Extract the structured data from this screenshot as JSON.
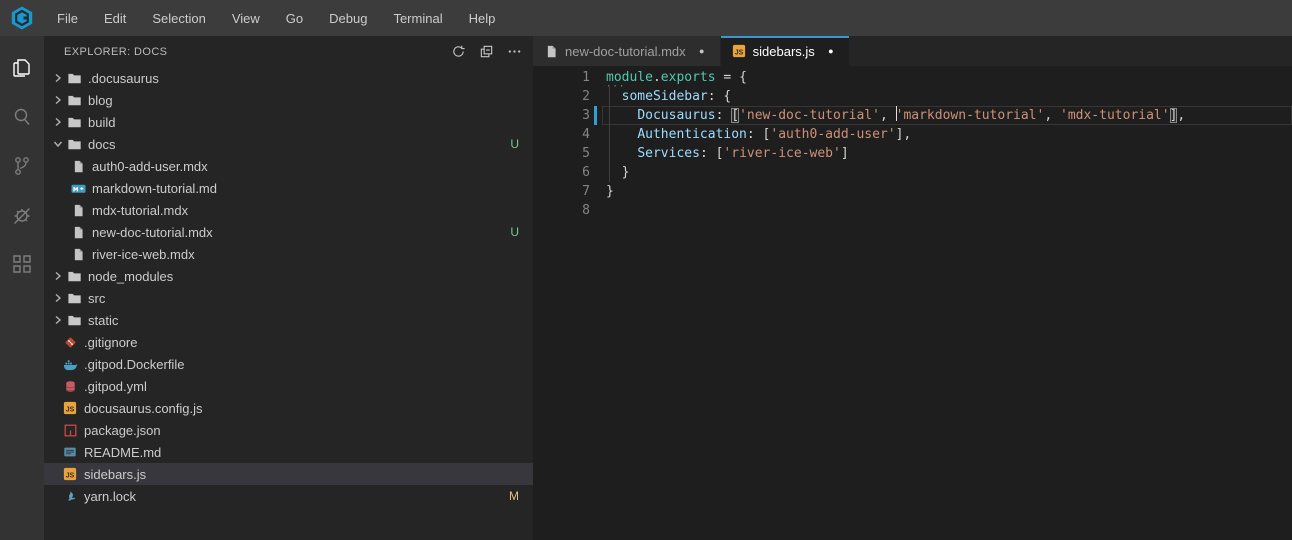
{
  "menubar": {
    "logo": "gitpod-logo",
    "items": [
      "File",
      "Edit",
      "Selection",
      "View",
      "Go",
      "Debug",
      "Terminal",
      "Help"
    ]
  },
  "activity_bar": {
    "items": [
      {
        "name": "explorer-icon",
        "active": true
      },
      {
        "name": "search-icon",
        "active": false
      },
      {
        "name": "source-control-icon",
        "active": false
      },
      {
        "name": "debug-icon",
        "active": false
      },
      {
        "name": "extensions-icon",
        "active": false
      }
    ]
  },
  "sidebar": {
    "title": "EXPLORER: DOCS",
    "actions": [
      {
        "name": "refresh-icon"
      },
      {
        "name": "collapse-folders-icon"
      },
      {
        "name": "more-actions-icon"
      }
    ],
    "tree": [
      {
        "type": "folder",
        "label": ".docusaurus",
        "depth": 0,
        "expanded": false,
        "badge": ""
      },
      {
        "type": "folder",
        "label": "blog",
        "depth": 0,
        "expanded": false,
        "badge": ""
      },
      {
        "type": "folder",
        "label": "build",
        "depth": 0,
        "expanded": false,
        "badge": ""
      },
      {
        "type": "folder",
        "label": "docs",
        "depth": 0,
        "expanded": true,
        "badge": "U"
      },
      {
        "type": "file",
        "icon": "file-icon",
        "label": "auth0-add-user.mdx",
        "depth": 1,
        "badge": ""
      },
      {
        "type": "file",
        "icon": "markdown-icon",
        "label": "markdown-tutorial.md",
        "depth": 1,
        "badge": ""
      },
      {
        "type": "file",
        "icon": "file-icon",
        "label": "mdx-tutorial.mdx",
        "depth": 1,
        "badge": ""
      },
      {
        "type": "file",
        "icon": "file-icon",
        "label": "new-doc-tutorial.mdx",
        "depth": 1,
        "badge": "U"
      },
      {
        "type": "file",
        "icon": "file-icon",
        "label": "river-ice-web.mdx",
        "depth": 1,
        "badge": ""
      },
      {
        "type": "folder",
        "label": "node_modules",
        "depth": 0,
        "expanded": false,
        "badge": ""
      },
      {
        "type": "folder",
        "label": "src",
        "depth": 0,
        "expanded": false,
        "badge": ""
      },
      {
        "type": "folder",
        "label": "static",
        "depth": 0,
        "expanded": false,
        "badge": ""
      },
      {
        "type": "file",
        "icon": "git-icon",
        "label": ".gitignore",
        "depth": 0,
        "badge": ""
      },
      {
        "type": "file",
        "icon": "docker-icon",
        "label": ".gitpod.Dockerfile",
        "depth": 0,
        "badge": ""
      },
      {
        "type": "file",
        "icon": "yaml-icon",
        "label": ".gitpod.yml",
        "depth": 0,
        "badge": ""
      },
      {
        "type": "file",
        "icon": "js-icon",
        "label": "docusaurus.config.js",
        "depth": 0,
        "badge": ""
      },
      {
        "type": "file",
        "icon": "npm-icon",
        "label": "package.json",
        "depth": 0,
        "badge": ""
      },
      {
        "type": "file",
        "icon": "readme-icon",
        "label": "README.md",
        "depth": 0,
        "badge": ""
      },
      {
        "type": "file",
        "icon": "js-icon",
        "label": "sidebars.js",
        "depth": 0,
        "badge": "",
        "selected": true
      },
      {
        "type": "file",
        "icon": "yarn-icon",
        "label": "yarn.lock",
        "depth": 0,
        "badge": "M"
      }
    ]
  },
  "tabs": [
    {
      "label": "new-doc-tutorial.mdx",
      "icon": "file-icon",
      "modified": true,
      "active": false
    },
    {
      "label": "sidebars.js",
      "icon": "js-icon",
      "modified": true,
      "active": true
    }
  ],
  "editor": {
    "file": "sidebars.js",
    "line_count": 8,
    "decorations": {
      "hint_dots": "···",
      "modified_dot": "●"
    },
    "lines": [
      {
        "n": 1,
        "hint": true,
        "guide": false,
        "modified": false,
        "current": false,
        "tokens": [
          [
            "teal",
            "module"
          ],
          [
            "fg",
            "."
          ],
          [
            "teal",
            "exports"
          ],
          [
            "fg",
            " = {"
          ]
        ]
      },
      {
        "n": 2,
        "hint": false,
        "guide": true,
        "modified": false,
        "current": false,
        "tokens": [
          [
            "fg",
            "  "
          ],
          [
            "blue",
            "someSidebar"
          ],
          [
            "fg",
            ": {"
          ]
        ]
      },
      {
        "n": 3,
        "hint": false,
        "guide": true,
        "modified": true,
        "current": true,
        "tokens": [
          [
            "fg",
            "    "
          ],
          [
            "blue",
            "Docusaurus"
          ],
          [
            "fg",
            ": "
          ],
          [
            "bracket",
            "["
          ],
          [
            "str",
            "'new-doc-tutorial'"
          ],
          [
            "fg",
            ", "
          ],
          [
            "caret",
            ""
          ],
          [
            "str",
            "'markdown-tutorial'"
          ],
          [
            "fg",
            ", "
          ],
          [
            "str",
            "'mdx-tutorial'"
          ],
          [
            "bracket",
            "]"
          ],
          [
            "fg",
            ","
          ]
        ]
      },
      {
        "n": 4,
        "hint": false,
        "guide": true,
        "modified": false,
        "current": false,
        "tokens": [
          [
            "fg",
            "    "
          ],
          [
            "blue",
            "Authentication"
          ],
          [
            "fg",
            ": ["
          ],
          [
            "str",
            "'auth0-add-user'"
          ],
          [
            "fg",
            "],"
          ]
        ]
      },
      {
        "n": 5,
        "hint": false,
        "guide": true,
        "modified": false,
        "current": false,
        "tokens": [
          [
            "fg",
            "    "
          ],
          [
            "blue",
            "Services"
          ],
          [
            "fg",
            ": ["
          ],
          [
            "str",
            "'river-ice-web'"
          ],
          [
            "fg",
            "]"
          ]
        ]
      },
      {
        "n": 6,
        "hint": false,
        "guide": true,
        "modified": false,
        "current": false,
        "tokens": [
          [
            "fg",
            "  }"
          ]
        ]
      },
      {
        "n": 7,
        "hint": false,
        "guide": false,
        "modified": false,
        "current": false,
        "tokens": [
          [
            "fg",
            "}"
          ]
        ]
      },
      {
        "n": 8,
        "hint": false,
        "guide": false,
        "modified": false,
        "current": false,
        "tokens": []
      }
    ]
  },
  "colors": {
    "menubar_bg": "#3c3c3c",
    "activitybar_bg": "#333333",
    "sidebar_bg": "#252526",
    "editor_bg": "#1e1e1e",
    "tab_active_border": "#3997cd",
    "selected_row_bg": "#37373d",
    "badge_untracked": "#73c991",
    "badge_modified": "#e2c08d",
    "gutter_modified_bar": "#2ea0d4",
    "syntax_teal": "#4ec9b0",
    "syntax_key_blue": "#9cdcfe",
    "syntax_string": "#ce9178",
    "syntax_fg": "#d4d4d4",
    "line_number": "#858585",
    "gitpod_blue": "#1699ce"
  }
}
